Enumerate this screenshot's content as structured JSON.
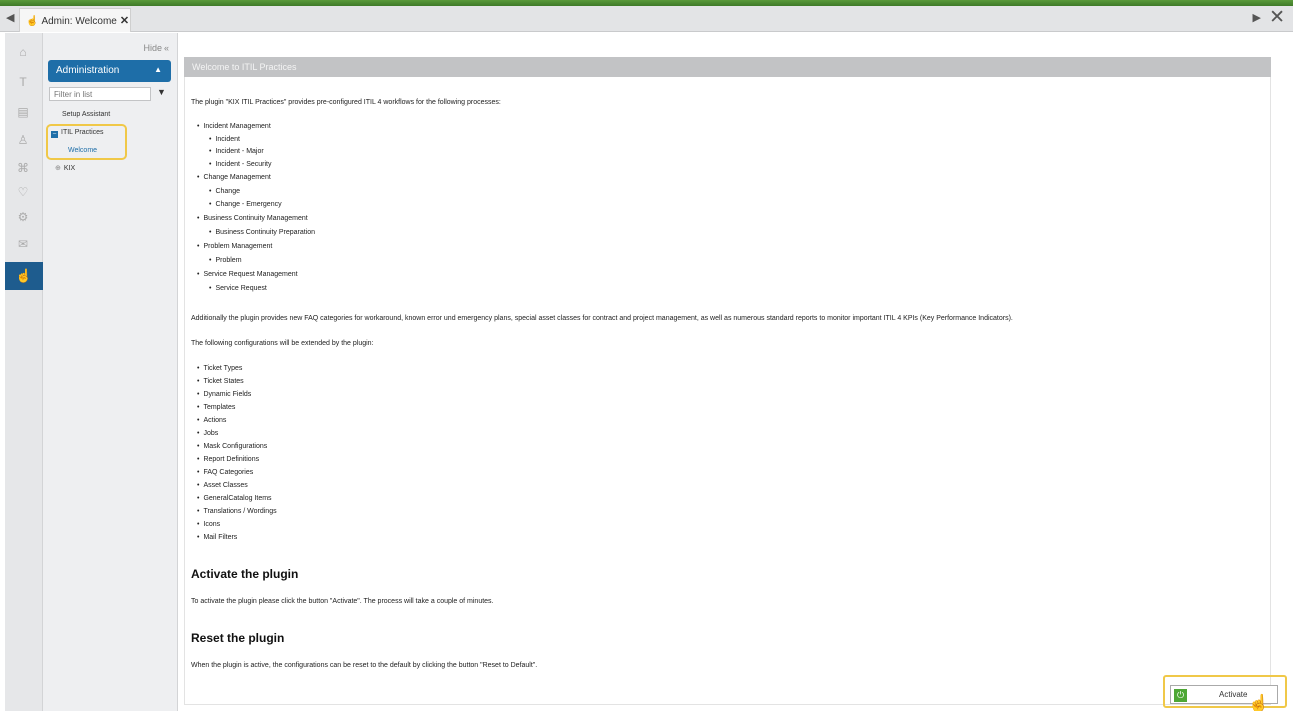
{
  "tab": {
    "title": "Admin: Welcome",
    "close": "✕"
  },
  "nav": {
    "left": "◀",
    "right": "▶",
    "close_all": "✕"
  },
  "sidebar": {
    "hide_label": "Hide",
    "hide_chevron": "«",
    "admin_title": "Administration",
    "admin_caret": "▲",
    "filter_placeholder": "Filter in list",
    "filter_icon": "funnel-icon",
    "setup": "Setup Assistant",
    "itil": "ITIL Practices",
    "itil_toggle": "–",
    "welcome": "Welcome",
    "kix": "KIX",
    "kix_toggle": "⊕"
  },
  "iconbar": [
    "home-icon",
    "tickets-icon",
    "documents-icon",
    "people-icon",
    "cmdb-icon",
    "faq-icon",
    "reports-icon",
    "announcement-icon",
    "admin-icon"
  ],
  "content": {
    "header": "Welcome to ITIL Practices",
    "intro": "The plugin \"KIX ITIL Practices\" provides pre-configured ITIL 4 workflows for the following processes:",
    "processes": [
      {
        "name": "Incident Management",
        "items": [
          "Incident",
          "Incident - Major",
          "Incident - Security"
        ]
      },
      {
        "name": "Change Management",
        "items": [
          "Change",
          "Change - Emergency"
        ]
      },
      {
        "name": "Business Continuity Management",
        "items": [
          "Business Continuity Preparation"
        ]
      },
      {
        "name": "Problem Management",
        "items": [
          "Problem"
        ]
      },
      {
        "name": "Service Request Management",
        "items": [
          "Service Request"
        ]
      }
    ],
    "additionally": "Additionally the plugin provides new FAQ categories for workaround, known error und emergency plans, special asset classes for contract and project management, as well as numerous standard reports to monitor important ITIL 4 KPIs (Key Performance Indicators).",
    "extended": "The following configurations will be extended by the plugin:",
    "configs": [
      "Ticket Types",
      "Ticket States",
      "Dynamic Fields",
      "Templates",
      "Actions",
      "Jobs",
      "Mask Configurations",
      "Report Definitions",
      "FAQ Categories",
      "Asset Classes",
      "GeneralCatalog Items",
      "Translations / Wordings",
      "Icons",
      "Mail Filters"
    ],
    "activate_heading": "Activate the plugin",
    "activate_text": "To activate the plugin please click the button \"Activate\". The process will take a couple of minutes.",
    "reset_heading": "Reset the plugin",
    "reset_text": "When the plugin is active, the configurations can be reset to the default by clicking the button \"Reset to Default\"."
  },
  "button": {
    "activate": "Activate",
    "icon": "power-icon"
  },
  "colors": {
    "accent": "#1e6ea8",
    "highlight": "#f0c848",
    "green": "#4ea735",
    "header": "#c2c3c5"
  }
}
